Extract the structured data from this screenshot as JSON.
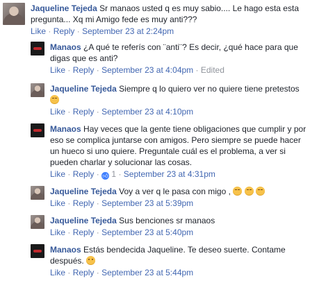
{
  "comments": [
    {
      "author": "Jaqueline Tejeda",
      "text_line1": "Sr manaos usted q es muy sabio.... Le hago esta esta",
      "text_line2": "pregunta... Xq mi Amigo fede es muy anti???",
      "like": "Like",
      "reply": "Reply",
      "time": "September 23 at 2:24pm"
    },
    {
      "author": "Manaos",
      "text_line1": "¿A qué te referís con ¨anti¨? Es decir, ¿qué hace para que",
      "text_line2": "digas que es anti?",
      "like": "Like",
      "reply": "Reply",
      "time": "September 23 at 4:04pm",
      "edited": "Edited"
    },
    {
      "author": "Jaqueline Tejeda",
      "text_line1": "Siempre q lo quiero ver no quiere tiene pretestos",
      "emoji": "crying-face-icon",
      "like": "Like",
      "reply": "Reply",
      "time": "September 23 at 4:10pm"
    },
    {
      "author": "Manaos",
      "text_line1": "Hay veces que la gente tiene obligaciones que cumplir y por",
      "text_line2": "eso se complica juntarse con amigos. Pero siempre se puede hacer",
      "text_line3": "un hueco si uno quiere. Preguntale cuál es el problema, a ver si",
      "text_line4": "pueden charlar y solucionar las cosas.",
      "like": "Like",
      "reply": "Reply",
      "reactions": "1",
      "time": "September 23 at 4:31pm"
    },
    {
      "author": "Jaqueline Tejeda",
      "text_line1": "Voy a ver q le pasa con migo ,",
      "emoji": "disappointed-face-icon",
      "like": "Like",
      "reply": "Reply",
      "time": "September 23 at 5:39pm"
    },
    {
      "author": "Jaqueline Tejeda",
      "text_line1": "Sus benciones sr manaos",
      "like": "Like",
      "reply": "Reply",
      "time": "September 23 at 5:40pm"
    },
    {
      "author": "Manaos",
      "text_line1": "Estás bendecida Jaqueline. Te deseo suerte. Contame",
      "text_line2": "después.",
      "emoji": "smiling-face-icon",
      "like": "Like",
      "reply": "Reply",
      "time": "September 23 at 5:44pm"
    }
  ],
  "colors": {
    "author": "#365899",
    "link": "#4267b2",
    "meta": "#90949c",
    "text": "#1d2129"
  }
}
